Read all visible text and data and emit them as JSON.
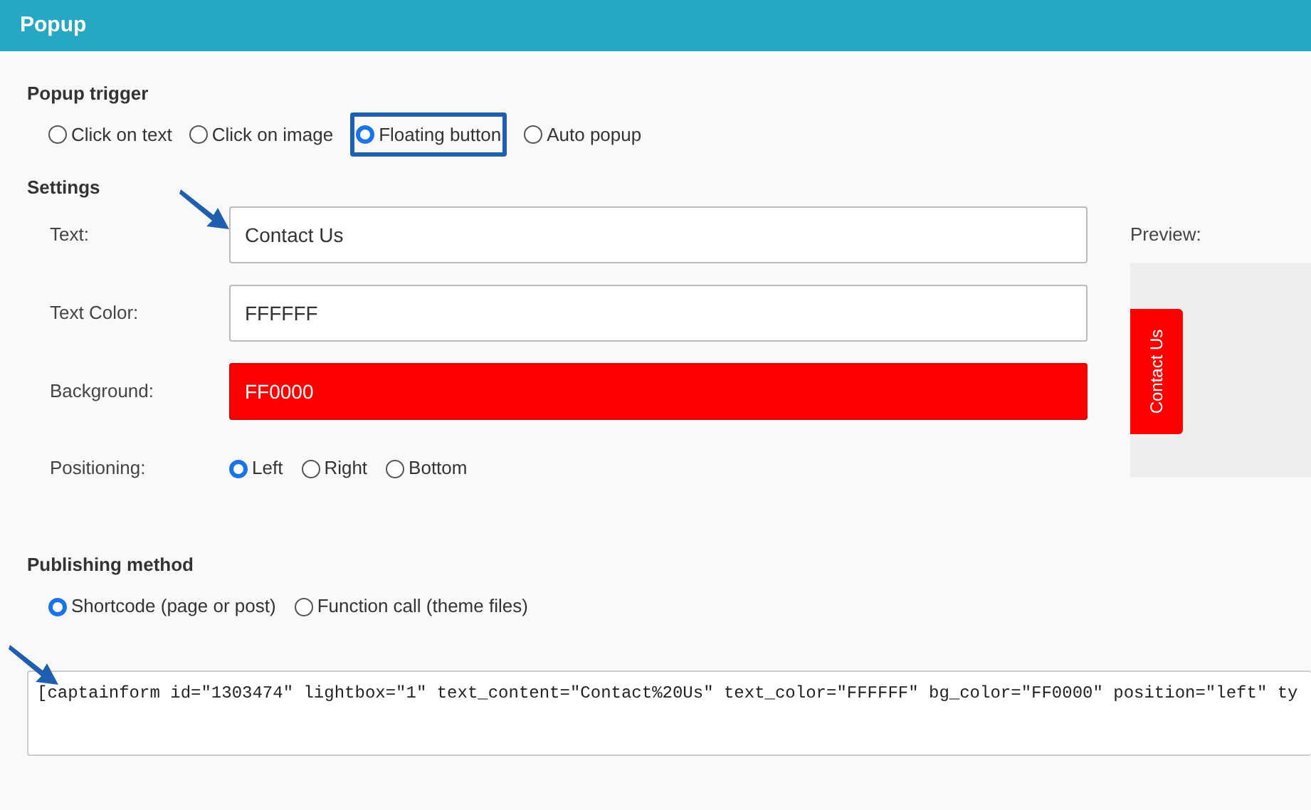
{
  "header": {
    "title": "Popup"
  },
  "popup_trigger": {
    "heading": "Popup trigger",
    "options": [
      {
        "label": "Click on text",
        "selected": false,
        "highlighted": false
      },
      {
        "label": "Click on image",
        "selected": false,
        "highlighted": false
      },
      {
        "label": "Floating button",
        "selected": true,
        "highlighted": true
      },
      {
        "label": "Auto popup",
        "selected": false,
        "highlighted": false
      }
    ]
  },
  "settings": {
    "heading": "Settings",
    "fields": [
      {
        "label": "Text:",
        "value": "Contact Us",
        "kind": "text"
      },
      {
        "label": "Text Color:",
        "value": "FFFFFF",
        "kind": "color"
      },
      {
        "label": "Background:",
        "value": "FF0000",
        "kind": "background"
      }
    ],
    "positioning": {
      "label": "Positioning:",
      "options": [
        {
          "label": "Left",
          "selected": true
        },
        {
          "label": "Right",
          "selected": false
        },
        {
          "label": "Bottom",
          "selected": false
        }
      ]
    }
  },
  "preview": {
    "label": "Preview:",
    "button_text": "Contact Us"
  },
  "publishing_method": {
    "heading": "Publishing method",
    "options": [
      {
        "label": "Shortcode (page or post)",
        "selected": true
      },
      {
        "label": "Function call (theme files)",
        "selected": false
      }
    ],
    "code": "[captainform id=\"1303474\" lightbox=\"1\" text_content=\"Contact%20Us\" text_color=\"FFFFFF\" bg_color=\"FF0000\" position=\"left\" ty"
  }
}
